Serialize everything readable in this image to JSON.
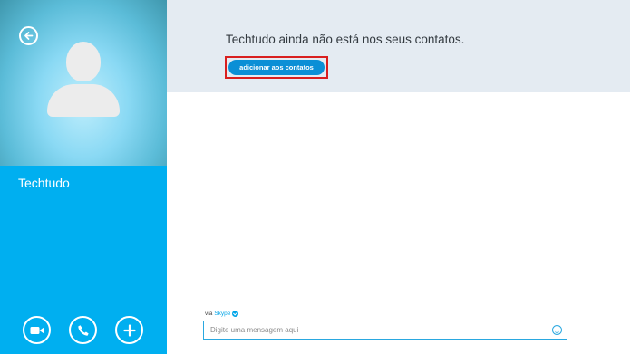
{
  "contact": {
    "name": "Techtudo"
  },
  "notice": {
    "text": "Techtudo ainda não está nos seus contatos.",
    "button_label": "adicionar aos contatos"
  },
  "composer": {
    "via_label": "via",
    "via_service": "Skype",
    "placeholder": "Digite uma mensagem aqui"
  },
  "icons": {
    "back": "back-arrow-icon",
    "video": "video-camera-icon",
    "call": "phone-icon",
    "add": "plus-icon",
    "emoji": "emoticon-icon"
  },
  "colors": {
    "sidebar": "#00aff0",
    "notice_bar": "#e4ebf2",
    "button": "#0b8fd6",
    "highlight": "#d91f1f"
  }
}
